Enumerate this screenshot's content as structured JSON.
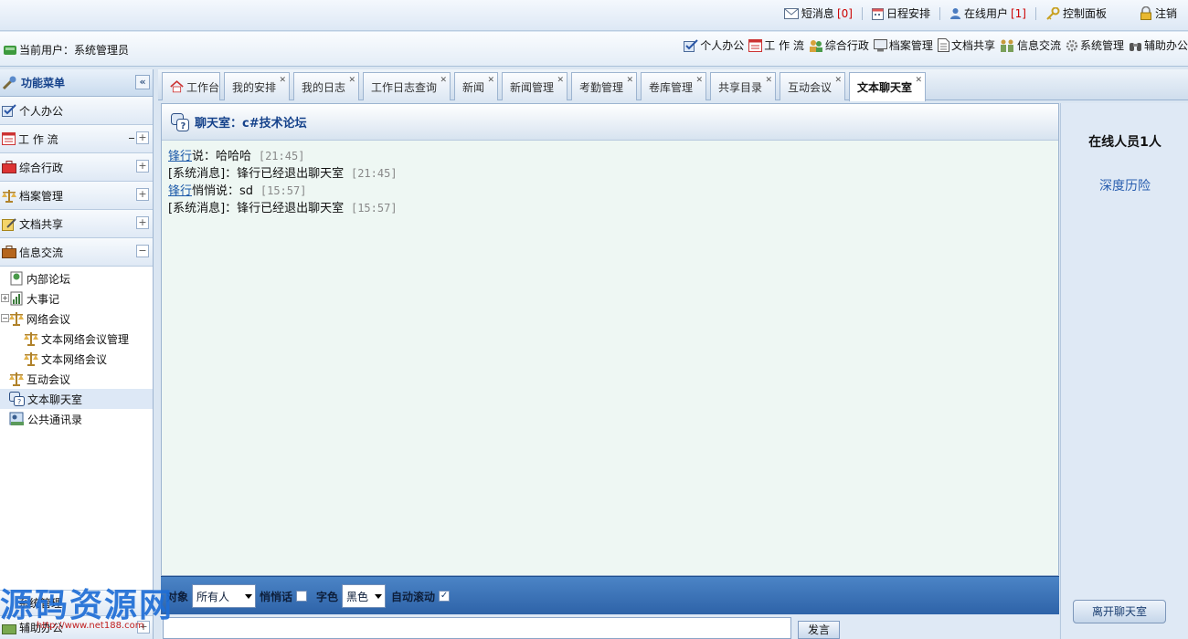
{
  "topbar": {
    "sms_label": "短消息",
    "sms_count": "[0]",
    "schedule_label": "日程安排",
    "online_label": "在线用户",
    "online_count": "[1]",
    "panel_label": "控制面板",
    "logout_label": "注销"
  },
  "userbar": {
    "current_user": "当前用户：系统管理员",
    "modules": [
      "个人办公",
      "工 作 流",
      "综合行政",
      "档案管理",
      "文档共享",
      "信息交流",
      "系统管理",
      "辅助办公"
    ]
  },
  "sidebar": {
    "title": "功能菜单",
    "collapse": "«",
    "sections": [
      {
        "label": "个人办公",
        "toggle": ""
      },
      {
        "label": "工 作 流",
        "toggle": "+"
      },
      {
        "label": "综合行政",
        "toggle": "+"
      },
      {
        "label": "档案管理",
        "toggle": "+"
      },
      {
        "label": "文档共享",
        "toggle": "+"
      },
      {
        "label": "信息交流",
        "toggle": "−"
      }
    ],
    "tree": [
      {
        "label": "内部论坛"
      },
      {
        "label": "大事记"
      },
      {
        "label": "网络会议"
      },
      {
        "label": "文本网络会议管理"
      },
      {
        "label": "文本网络会议"
      },
      {
        "label": "互动会议"
      },
      {
        "label": "文本聊天室"
      },
      {
        "label": "公共通讯录"
      }
    ],
    "bottom_sections": [
      {
        "label": "系统管理"
      },
      {
        "label": "辅助办公",
        "toggle": "+"
      }
    ]
  },
  "tabs": [
    {
      "label": "工作台"
    },
    {
      "label": "我的安排"
    },
    {
      "label": "我的日志"
    },
    {
      "label": "工作日志查询"
    },
    {
      "label": "新闻"
    },
    {
      "label": "新闻管理"
    },
    {
      "label": "考勤管理"
    },
    {
      "label": "卷库管理"
    },
    {
      "label": "共享目录"
    },
    {
      "label": "互动会议"
    },
    {
      "label": "文本聊天室"
    }
  ],
  "chat": {
    "title": "聊天室：c#技术论坛",
    "messages": [
      {
        "who": "锋行",
        "text": "说：哈哈哈",
        "time": "[21:45]"
      },
      {
        "who": "",
        "text": "[系统消息]：锋行已经退出聊天室",
        "time": "[21:45]"
      },
      {
        "who": "锋行",
        "text": "悄悄说：sd",
        "time": "[15:57]"
      },
      {
        "who": "",
        "text": "[系统消息]：锋行已经退出聊天室",
        "time": "[15:57]"
      }
    ]
  },
  "online": {
    "count_label": "在线人员1人",
    "users": [
      "深度历险"
    ],
    "leave_label": "离开聊天室"
  },
  "compose": {
    "to_label": "对象",
    "to_value": "所有人",
    "whisper_label": "悄悄话",
    "color_label": "字色",
    "color_value": "黑色",
    "autoscroll_label": "自动滚动",
    "autoscroll_check": "✓",
    "send_label": "发言"
  },
  "watermark": {
    "text": "源码资源网",
    "url": "http://www.net188.com"
  },
  "colors": {
    "accent": "#15428b",
    "compose_bar": "#3a6fb3",
    "link": "#1a58a8"
  }
}
